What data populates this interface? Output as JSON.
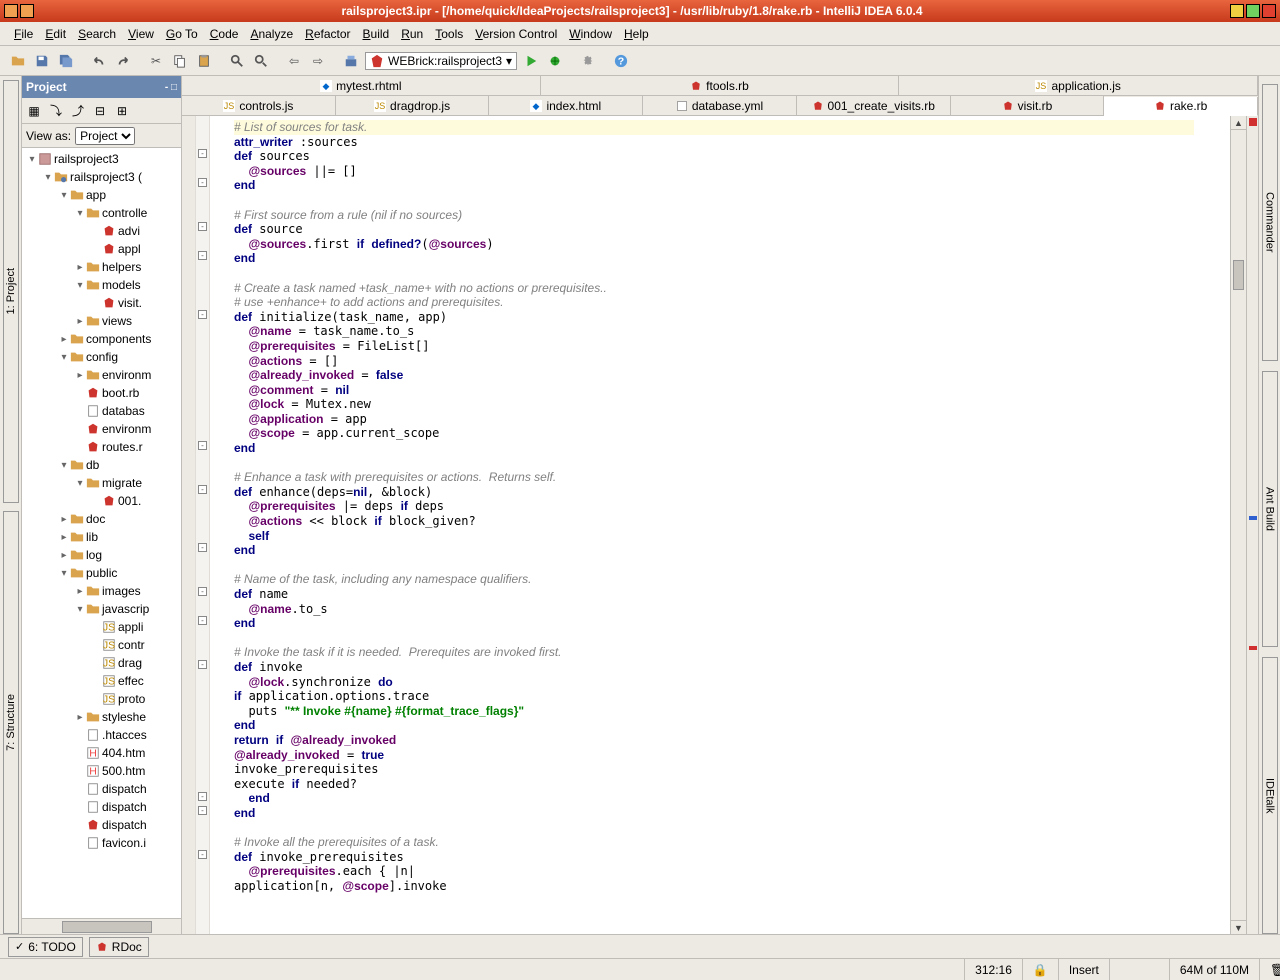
{
  "window": {
    "title": "railsproject3.ipr - [/home/quick/IdeaProjects/railsproject3] - /usr/lib/ruby/1.8/rake.rb - IntelliJ IDEA 6.0.4"
  },
  "menu": {
    "items": [
      "File",
      "Edit",
      "Search",
      "View",
      "Go To",
      "Code",
      "Analyze",
      "Refactor",
      "Build",
      "Run",
      "Tools",
      "Version Control",
      "Window",
      "Help"
    ]
  },
  "runconfig": {
    "label": "WEBrick:railsproject3"
  },
  "project_panel": {
    "title": "Project",
    "view_as_label": "View as:",
    "view_as_value": "Project"
  },
  "left_tools": [
    "1: Project",
    "7: Structure"
  ],
  "right_tools": [
    "Commander",
    "Ant Build",
    "IDEtalk"
  ],
  "tree": [
    {
      "d": 0,
      "e": "-",
      "t": "proj",
      "l": "railsproject3"
    },
    {
      "d": 1,
      "e": "-",
      "t": "mod",
      "l": "railsproject3 ("
    },
    {
      "d": 2,
      "e": "-",
      "t": "dir",
      "l": "app"
    },
    {
      "d": 3,
      "e": "-",
      "t": "dir",
      "l": "controlle"
    },
    {
      "d": 4,
      "e": "",
      "t": "rb",
      "l": "advi"
    },
    {
      "d": 4,
      "e": "",
      "t": "rb",
      "l": "appl"
    },
    {
      "d": 3,
      "e": "+",
      "t": "dir",
      "l": "helpers"
    },
    {
      "d": 3,
      "e": "-",
      "t": "dir",
      "l": "models"
    },
    {
      "d": 4,
      "e": "",
      "t": "rb",
      "l": "visit."
    },
    {
      "d": 3,
      "e": "+",
      "t": "dir",
      "l": "views"
    },
    {
      "d": 2,
      "e": "+",
      "t": "dir",
      "l": "components"
    },
    {
      "d": 2,
      "e": "-",
      "t": "dir",
      "l": "config"
    },
    {
      "d": 3,
      "e": "+",
      "t": "dir",
      "l": "environm"
    },
    {
      "d": 3,
      "e": "",
      "t": "rb",
      "l": "boot.rb"
    },
    {
      "d": 3,
      "e": "",
      "t": "file",
      "l": "databas"
    },
    {
      "d": 3,
      "e": "",
      "t": "rb",
      "l": "environm"
    },
    {
      "d": 3,
      "e": "",
      "t": "rb",
      "l": "routes.r"
    },
    {
      "d": 2,
      "e": "-",
      "t": "dir",
      "l": "db"
    },
    {
      "d": 3,
      "e": "-",
      "t": "dir",
      "l": "migrate"
    },
    {
      "d": 4,
      "e": "",
      "t": "rb",
      "l": "001."
    },
    {
      "d": 2,
      "e": "+",
      "t": "dir",
      "l": "doc"
    },
    {
      "d": 2,
      "e": "+",
      "t": "dir",
      "l": "lib"
    },
    {
      "d": 2,
      "e": "+",
      "t": "dir",
      "l": "log"
    },
    {
      "d": 2,
      "e": "-",
      "t": "dir",
      "l": "public"
    },
    {
      "d": 3,
      "e": "+",
      "t": "dir",
      "l": "images"
    },
    {
      "d": 3,
      "e": "-",
      "t": "dir",
      "l": "javascrip"
    },
    {
      "d": 4,
      "e": "",
      "t": "js",
      "l": "appli"
    },
    {
      "d": 4,
      "e": "",
      "t": "js",
      "l": "contr"
    },
    {
      "d": 4,
      "e": "",
      "t": "js",
      "l": "drag"
    },
    {
      "d": 4,
      "e": "",
      "t": "js",
      "l": "effec"
    },
    {
      "d": 4,
      "e": "",
      "t": "js",
      "l": "proto"
    },
    {
      "d": 3,
      "e": "+",
      "t": "dir",
      "l": "styleshe"
    },
    {
      "d": 3,
      "e": "",
      "t": "file",
      "l": ".htacces"
    },
    {
      "d": 3,
      "e": "",
      "t": "html",
      "l": "404.htm"
    },
    {
      "d": 3,
      "e": "",
      "t": "html",
      "l": "500.htm"
    },
    {
      "d": 3,
      "e": "",
      "t": "file",
      "l": "dispatch"
    },
    {
      "d": 3,
      "e": "",
      "t": "file",
      "l": "dispatch"
    },
    {
      "d": 3,
      "e": "",
      "t": "rb",
      "l": "dispatch"
    },
    {
      "d": 3,
      "e": "",
      "t": "file",
      "l": "favicon.i"
    }
  ],
  "editor_tabs_top": [
    {
      "icon": "rhtml",
      "label": "mytest.rhtml"
    },
    {
      "icon": "rb",
      "label": "ftools.rb"
    },
    {
      "icon": "js",
      "label": "application.js"
    }
  ],
  "editor_tabs_bottom": [
    {
      "icon": "js",
      "label": "controls.js"
    },
    {
      "icon": "js",
      "label": "dragdrop.js"
    },
    {
      "icon": "html",
      "label": "index.html"
    },
    {
      "icon": "yml",
      "label": "database.yml"
    },
    {
      "icon": "rb",
      "label": "001_create_visits.rb"
    },
    {
      "icon": "rb",
      "label": "visit.rb"
    },
    {
      "icon": "rb",
      "label": "rake.rb",
      "active": true
    }
  ],
  "code_lines": [
    {
      "hl": true,
      "seg": [
        [
          "c",
          "# List of sources for task."
        ]
      ]
    },
    {
      "seg": [
        [
          "k",
          "attr_writer"
        ],
        [
          "",
          " :sources"
        ]
      ]
    },
    {
      "seg": [
        [
          "k",
          "def"
        ],
        [
          "",
          " sources"
        ]
      ]
    },
    {
      "seg": [
        [
          "",
          "  "
        ],
        [
          "iv",
          "@sources"
        ],
        [
          "",
          " ||= []"
        ]
      ]
    },
    {
      "seg": [
        [
          "k",
          "end"
        ]
      ]
    },
    {
      "seg": [
        [
          "",
          ""
        ]
      ]
    },
    {
      "seg": [
        [
          "c",
          "# First source from a rule (nil if no sources)"
        ]
      ]
    },
    {
      "seg": [
        [
          "k",
          "def"
        ],
        [
          "",
          " source"
        ]
      ]
    },
    {
      "seg": [
        [
          "",
          "  "
        ],
        [
          "iv",
          "@sources"
        ],
        [
          "",
          ".first "
        ],
        [
          "k",
          "if"
        ],
        [
          "",
          " "
        ],
        [
          "k",
          "defined?"
        ],
        [
          "",
          "("
        ],
        [
          "iv",
          "@sources"
        ],
        [
          "",
          ")"
        ]
      ]
    },
    {
      "seg": [
        [
          "k",
          "end"
        ]
      ]
    },
    {
      "seg": [
        [
          "",
          ""
        ]
      ]
    },
    {
      "seg": [
        [
          "c",
          "# Create a task named +task_name+ with no actions or prerequisites.."
        ]
      ]
    },
    {
      "seg": [
        [
          "c",
          "# use +enhance+ to add actions and prerequisites."
        ]
      ]
    },
    {
      "seg": [
        [
          "k",
          "def"
        ],
        [
          "",
          " initialize(task_name, app)"
        ]
      ]
    },
    {
      "seg": [
        [
          "",
          "  "
        ],
        [
          "iv",
          "@name"
        ],
        [
          "",
          " = task_name.to_s"
        ]
      ]
    },
    {
      "seg": [
        [
          "",
          "  "
        ],
        [
          "iv",
          "@prerequisites"
        ],
        [
          "",
          " = FileList[]"
        ]
      ]
    },
    {
      "seg": [
        [
          "",
          "  "
        ],
        [
          "iv",
          "@actions"
        ],
        [
          "",
          " = []"
        ]
      ]
    },
    {
      "seg": [
        [
          "",
          "  "
        ],
        [
          "iv",
          "@already_invoked"
        ],
        [
          "",
          " = "
        ],
        [
          "k",
          "false"
        ]
      ]
    },
    {
      "seg": [
        [
          "",
          "  "
        ],
        [
          "iv",
          "@comment"
        ],
        [
          "",
          " = "
        ],
        [
          "k",
          "nil"
        ]
      ]
    },
    {
      "seg": [
        [
          "",
          "  "
        ],
        [
          "iv",
          "@lock"
        ],
        [
          "",
          " = Mutex.new"
        ]
      ]
    },
    {
      "seg": [
        [
          "",
          "  "
        ],
        [
          "iv",
          "@application"
        ],
        [
          "",
          " = app"
        ]
      ]
    },
    {
      "seg": [
        [
          "",
          "  "
        ],
        [
          "iv",
          "@scope"
        ],
        [
          "",
          " = app.current_scope"
        ]
      ]
    },
    {
      "seg": [
        [
          "k",
          "end"
        ]
      ]
    },
    {
      "seg": [
        [
          "",
          ""
        ]
      ]
    },
    {
      "seg": [
        [
          "c",
          "# Enhance a task with prerequisites or actions.  Returns self."
        ]
      ]
    },
    {
      "seg": [
        [
          "k",
          "def"
        ],
        [
          "",
          " enhance(deps="
        ],
        [
          "k",
          "nil"
        ],
        [
          "",
          ", &block)"
        ]
      ]
    },
    {
      "seg": [
        [
          "",
          "  "
        ],
        [
          "iv",
          "@prerequisites"
        ],
        [
          "",
          " |= deps "
        ],
        [
          "k",
          "if"
        ],
        [
          "",
          " deps"
        ]
      ]
    },
    {
      "seg": [
        [
          "",
          "  "
        ],
        [
          "iv",
          "@actions"
        ],
        [
          "",
          " << block "
        ],
        [
          "k",
          "if"
        ],
        [
          "",
          " block_given?"
        ]
      ]
    },
    {
      "seg": [
        [
          "",
          "  "
        ],
        [
          "k",
          "self"
        ]
      ]
    },
    {
      "seg": [
        [
          "k",
          "end"
        ]
      ]
    },
    {
      "seg": [
        [
          "",
          ""
        ]
      ]
    },
    {
      "seg": [
        [
          "c",
          "# Name of the task, including any namespace qualifiers."
        ]
      ]
    },
    {
      "seg": [
        [
          "k",
          "def"
        ],
        [
          "",
          " name"
        ]
      ]
    },
    {
      "seg": [
        [
          "",
          "  "
        ],
        [
          "iv",
          "@name"
        ],
        [
          "",
          ".to_s"
        ]
      ]
    },
    {
      "seg": [
        [
          "k",
          "end"
        ]
      ]
    },
    {
      "seg": [
        [
          "",
          ""
        ]
      ]
    },
    {
      "seg": [
        [
          "c",
          "# Invoke the task if it is needed.  Prerequites are invoked first."
        ]
      ]
    },
    {
      "seg": [
        [
          "k",
          "def"
        ],
        [
          "",
          " invoke"
        ]
      ]
    },
    {
      "seg": [
        [
          "",
          "  "
        ],
        [
          "iv",
          "@lock"
        ],
        [
          "",
          ".synchronize "
        ],
        [
          "k",
          "do"
        ]
      ]
    },
    {
      "seg": [
        [
          "k",
          "if"
        ],
        [
          "",
          " application.options.trace"
        ]
      ]
    },
    {
      "seg": [
        [
          "",
          "  puts "
        ],
        [
          "s",
          "\"** Invoke #{name} #{format_trace_flags}\""
        ]
      ]
    },
    {
      "seg": [
        [
          "k",
          "end"
        ]
      ]
    },
    {
      "seg": [
        [
          "k",
          "return"
        ],
        [
          "",
          " "
        ],
        [
          "k",
          "if"
        ],
        [
          "",
          " "
        ],
        [
          "iv",
          "@already_invoked"
        ]
      ]
    },
    {
      "seg": [
        [
          "iv",
          "@already_invoked"
        ],
        [
          "",
          " = "
        ],
        [
          "k",
          "true"
        ]
      ]
    },
    {
      "seg": [
        [
          "",
          "invoke_prerequisites"
        ]
      ]
    },
    {
      "seg": [
        [
          "",
          "execute "
        ],
        [
          "k",
          "if"
        ],
        [
          "",
          " needed?"
        ]
      ]
    },
    {
      "seg": [
        [
          "",
          "  "
        ],
        [
          "k",
          "end"
        ]
      ]
    },
    {
      "seg": [
        [
          "k",
          "end"
        ]
      ]
    },
    {
      "seg": [
        [
          "",
          ""
        ]
      ]
    },
    {
      "seg": [
        [
          "c",
          "# Invoke all the prerequisites of a task."
        ]
      ]
    },
    {
      "seg": [
        [
          "k",
          "def"
        ],
        [
          "",
          " invoke_prerequisites"
        ]
      ]
    },
    {
      "seg": [
        [
          "",
          "  "
        ],
        [
          "iv",
          "@prerequisites"
        ],
        [
          "",
          ".each { |n|"
        ]
      ]
    },
    {
      "seg": [
        [
          "",
          "application[n, "
        ],
        [
          "iv",
          "@scope"
        ],
        [
          "",
          "].invoke"
        ]
      ]
    }
  ],
  "fold_marks": [
    2,
    4,
    7,
    9,
    13,
    22,
    25,
    29,
    32,
    34,
    37,
    46,
    47,
    50
  ],
  "bottom_tools": [
    {
      "icon": "todo",
      "label": "6: TODO"
    },
    {
      "icon": "rb",
      "label": "RDoc"
    }
  ],
  "status": {
    "pos": "312:16",
    "lock": "🔒",
    "insert": "Insert",
    "mem": "64M of 110M"
  }
}
